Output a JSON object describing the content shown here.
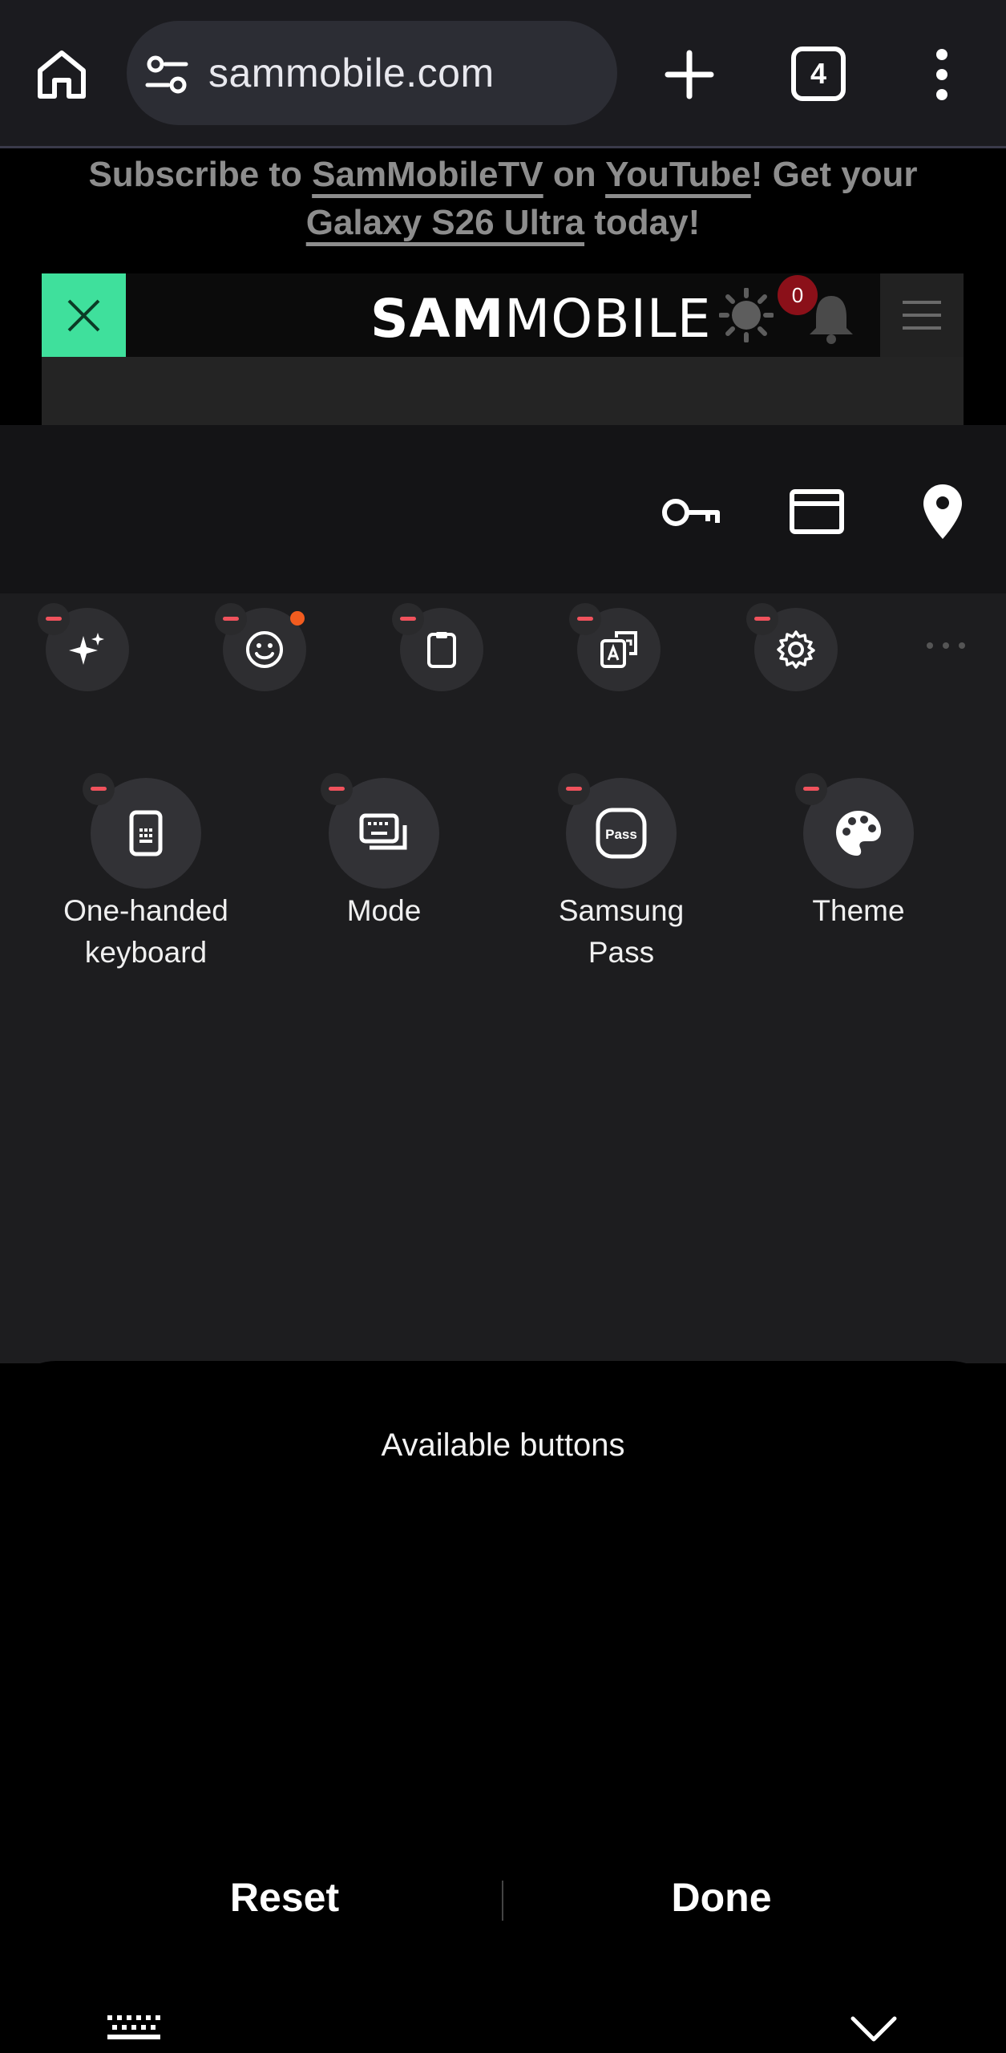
{
  "browser": {
    "url": "sammobile.com",
    "tab_count": "4",
    "icons": [
      "home-icon",
      "site-settings-icon",
      "new-tab-icon",
      "tab-switcher-icon",
      "more-vert-icon"
    ]
  },
  "banner": {
    "prefix": "Subscribe to ",
    "link1": "SamMobileTV",
    "mid": " on ",
    "link2": "YouTube",
    "suffix": "! Get your",
    "link3": "Galaxy S26 Ultra",
    "end": " today!"
  },
  "site": {
    "logo_bold": "SAM",
    "logo_light": "MOBILE",
    "notification_count": "0",
    "accent_color": "#3fe09c"
  },
  "autofill": {
    "icons": [
      "password-key-icon",
      "payment-card-icon",
      "address-pin-icon"
    ]
  },
  "toolbar": {
    "buttons": [
      {
        "icon": "galaxy-ai-sparkle-icon"
      },
      {
        "icon": "emoji-icon",
        "has_new_dot": true
      },
      {
        "icon": "clipboard-icon"
      },
      {
        "icon": "translate-icon"
      },
      {
        "icon": "settings-gear-icon"
      }
    ]
  },
  "added_buttons": [
    {
      "label": "One-handed keyboard",
      "line1": "One-handed",
      "line2": "keyboard",
      "icon": "one-handed-keyboard-icon"
    },
    {
      "label": "Mode",
      "line1": "Mode",
      "line2": "",
      "icon": "keyboard-mode-icon"
    },
    {
      "label": "Samsung Pass",
      "line1": "Samsung",
      "line2": "Pass",
      "icon": "samsung-pass-icon"
    },
    {
      "label": "Theme",
      "line1": "Theme",
      "line2": "",
      "icon": "palette-icon"
    }
  ],
  "sheet": {
    "title": "Available buttons",
    "reset_label": "Reset",
    "done_label": "Done"
  },
  "colors": {
    "remove_badge": "#f0525c",
    "new_dot": "#f25c1f"
  }
}
